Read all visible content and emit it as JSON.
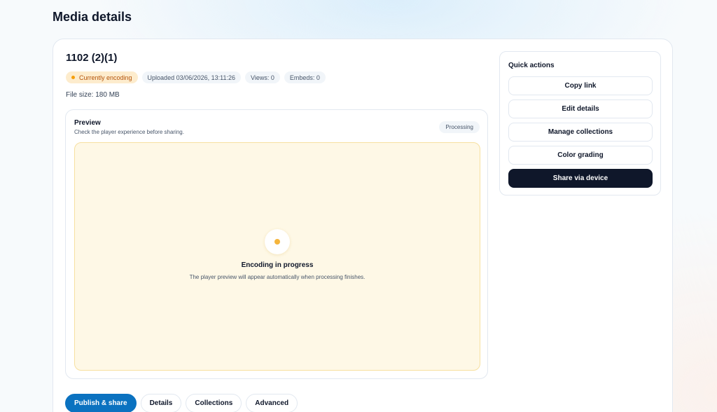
{
  "page": {
    "title": "Media details"
  },
  "media": {
    "title": "1102 (2)(1)",
    "badges": {
      "status": "Currently encoding",
      "uploaded": "Uploaded 03/06/2026, 13:11:26",
      "views": "Views: 0",
      "embeds": "Embeds: 0"
    },
    "file_size": "File size: 180 MB"
  },
  "preview": {
    "title": "Preview",
    "subtitle": "Check the player experience before sharing.",
    "status_badge": "Processing",
    "encoding_title": "Encoding in progress",
    "encoding_message": "The player preview will appear automatically when processing finishes."
  },
  "quick_actions": {
    "title": "Quick actions",
    "copy_link": "Copy link",
    "edit_details": "Edit details",
    "manage_collections": "Manage collections",
    "color_grading": "Color grading",
    "share_via_device": "Share via device"
  },
  "tabs": [
    {
      "label": "Publish & share",
      "active": true
    },
    {
      "label": "Details",
      "active": false
    },
    {
      "label": "Collections",
      "active": false
    },
    {
      "label": "Advanced",
      "active": false
    }
  ],
  "colors": {
    "accent": "#0b72c0",
    "dark_button": "#0f172a",
    "encoding_badge_bg": "#fdeccd",
    "encoding_dot": "#f59e0b",
    "preview_bg": "#fef8e6"
  }
}
